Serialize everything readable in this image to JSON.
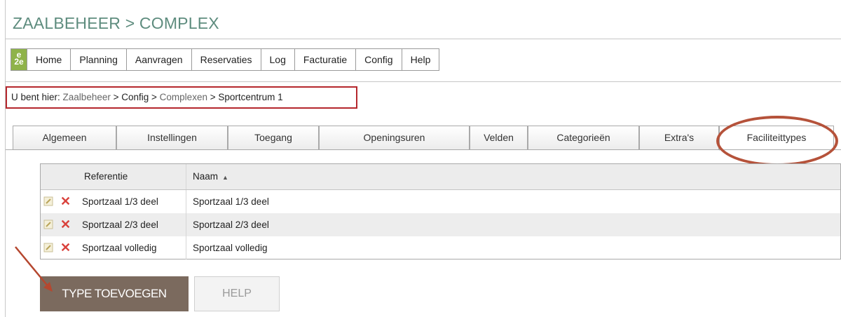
{
  "header": {
    "title": "ZAALBEHEER > COMPLEX"
  },
  "logo": {
    "line1": "e",
    "line2": "2e"
  },
  "nav": {
    "items": [
      "Home",
      "Planning",
      "Aanvragen",
      "Reservaties",
      "Log",
      "Facturatie",
      "Config",
      "Help"
    ]
  },
  "breadcrumb": {
    "prefix": "U bent hier: ",
    "item1": "Zaalbeheer",
    "sep": " > ",
    "item2": "Config",
    "item3": "Complexen",
    "item4": "Sportcentrum 1"
  },
  "tabs": {
    "items": [
      "Algemeen",
      "Instellingen",
      "Toegang",
      "Openingsuren",
      "Velden",
      "Categorieën",
      "Extra's",
      "Faciliteittypes"
    ],
    "active": "Faciliteittypes"
  },
  "grid": {
    "columns": {
      "ref": "Referentie",
      "naam": "Naam"
    },
    "rows": [
      {
        "ref": "Sportzaal 1/3 deel",
        "naam": "Sportzaal 1/3 deel"
      },
      {
        "ref": "Sportzaal 2/3 deel",
        "naam": "Sportzaal 2/3 deel"
      },
      {
        "ref": "Sportzaal volledig",
        "naam": "Sportzaal volledig"
      }
    ]
  },
  "buttons": {
    "add": "TYPE TOEVOEGEN",
    "help": "HELP"
  },
  "colors": {
    "title": "#5e8c7e",
    "annotation": "#b5272d",
    "add_button": "#7b6a5e",
    "logo": "#8fb34a"
  }
}
